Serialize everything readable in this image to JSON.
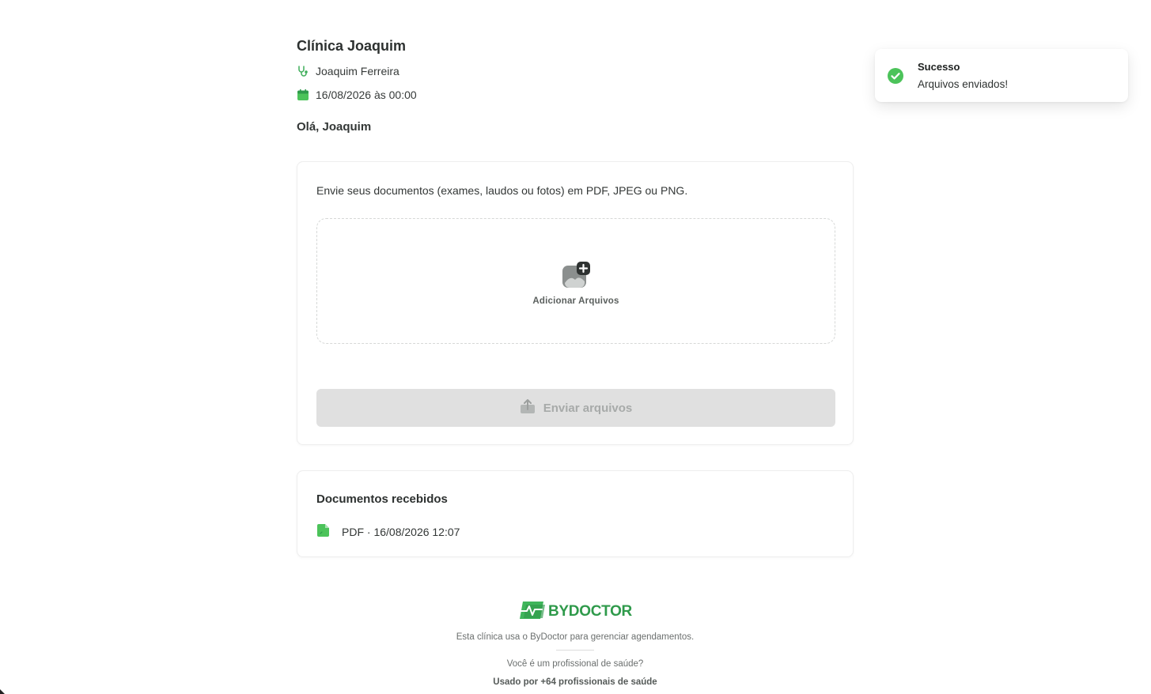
{
  "header": {
    "clinic_name": "Clínica Joaquim",
    "doctor_name": "Joaquim Ferreira",
    "appointment_datetime": "16/08/2026 às 00:00",
    "greeting": "Olá, Joaquim"
  },
  "upload": {
    "description": "Envie seus documentos (exames, laudos ou fotos) em PDF, JPEG ou PNG.",
    "dropzone_label": "Adicionar Arquivos",
    "send_button_label": "Enviar arquivos",
    "send_button_disabled": true
  },
  "received": {
    "title": "Documentos recebidos",
    "items": [
      {
        "label": "PDF · 16/08/2026 12:07",
        "icon": "file-icon"
      }
    ]
  },
  "footer": {
    "brand": "BYDOCTOR",
    "tagline": "Esta clínica usa o ByDoctor para gerenciar agendamentos.",
    "question": "Você é um profissional de saúde?",
    "used_by": "Usado por +64 profissionais de saúde"
  },
  "toast": {
    "title": "Sucesso",
    "message": "Arquivos enviados!",
    "icon": "check-circle-icon"
  },
  "colors": {
    "accent": "#2f9a4b",
    "success": "#4cc35a",
    "disabled_button": "#e0e0e0"
  }
}
